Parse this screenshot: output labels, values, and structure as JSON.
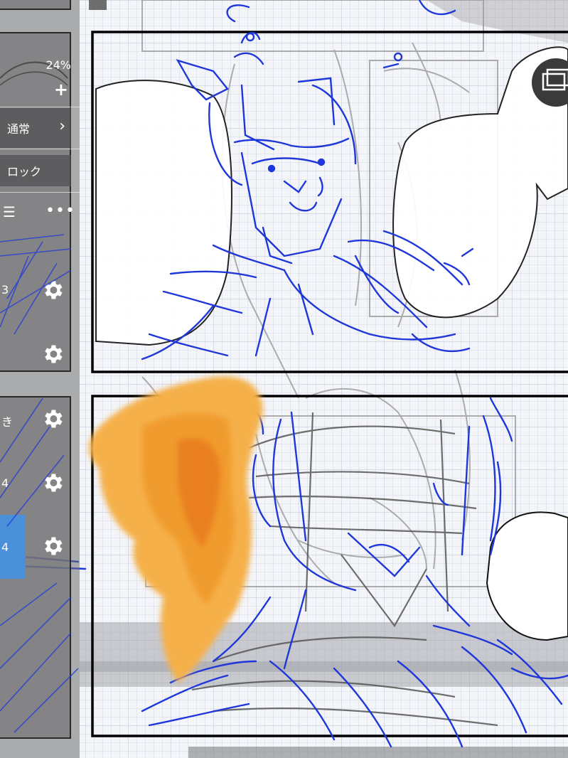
{
  "toolbar": {
    "opacity": "24%",
    "add_symbol": "+",
    "blend_mode": "通常",
    "lock_label": "ロック",
    "menu_icon": "list-icon",
    "more_icon": "more-icon"
  },
  "layers": [
    {
      "label": "3",
      "selected": false
    },
    {
      "label": "",
      "selected": false
    },
    {
      "label": "き",
      "selected": false
    },
    {
      "label": "4",
      "selected": false
    },
    {
      "label": "4",
      "selected": true
    }
  ],
  "canvas": {
    "sketch_ink": "#1f37d9",
    "rough_ink": "#9a9a9a",
    "orange_paint": "#f0992a",
    "panel_border": "#000000",
    "grid_color": "#c9d1e0",
    "overlay_button_icon": "frame-icon"
  },
  "colors": {
    "panel_bg": "#767678",
    "selected_layer": "#4a90d9",
    "text": "#ffffff"
  }
}
